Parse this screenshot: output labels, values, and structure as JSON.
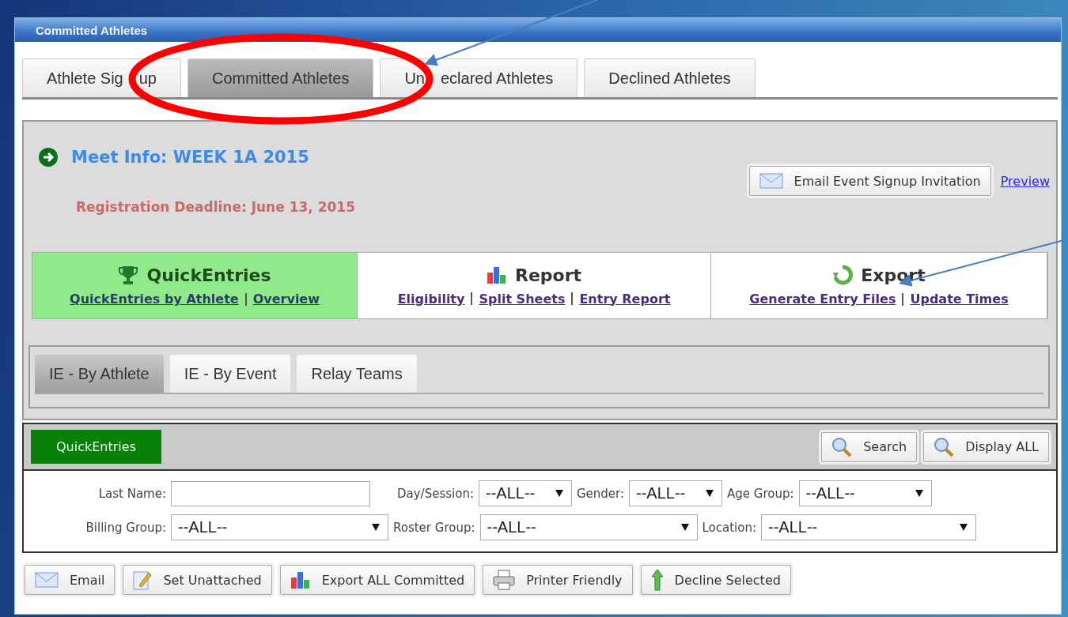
{
  "window": {
    "title": "Committed Athletes"
  },
  "tabs": [
    {
      "label_parts": [
        "Athlete Sig",
        "up"
      ],
      "selected": false
    },
    {
      "label_parts": [
        "Committed Athletes"
      ],
      "selected": true
    },
    {
      "label_parts": [
        "Un",
        "eclared Athletes"
      ],
      "selected": false
    },
    {
      "label_parts": [
        "Declined Athletes"
      ],
      "selected": false
    }
  ],
  "meet": {
    "title": "Meet Info: WEEK 1A 2015",
    "deadline": "Registration Deadline: June 13, 2015",
    "email_button": "Email Event Signup Invitation",
    "preview_link": "Preview"
  },
  "sections": [
    {
      "kind": "trophy",
      "title": "QuickEntries",
      "selected": true,
      "links": [
        "QuickEntries by Athlete",
        "Overview"
      ]
    },
    {
      "kind": "chart",
      "title": "Report",
      "selected": false,
      "links": [
        "Eligibility",
        "Split Sheets",
        "Entry Report"
      ]
    },
    {
      "kind": "recycle",
      "title": "Export",
      "selected": false,
      "links": [
        "Generate Entry Files",
        "Update Times"
      ]
    }
  ],
  "subtabs": [
    {
      "label": "IE - By Athlete",
      "selected": true
    },
    {
      "label": "IE - By Event",
      "selected": false
    },
    {
      "label": "Relay Teams",
      "selected": false
    }
  ],
  "panel": {
    "label": "QuickEntries",
    "buttons": [
      "Search",
      "Display ALL"
    ]
  },
  "filters": [
    [
      {
        "label": "Last Name:",
        "kind": "text"
      },
      {
        "label": "Day/Session:",
        "kind": "select",
        "value": "--ALL--"
      },
      {
        "label": "Gender:",
        "kind": "select",
        "value": "--ALL--"
      },
      {
        "label": "Age Group:",
        "kind": "select",
        "value": "--ALL--"
      }
    ],
    [
      {
        "label": "Billing Group:",
        "kind": "select",
        "value": "--ALL--"
      },
      {
        "label": "Roster Group:",
        "kind": "select",
        "value": "--ALL--"
      },
      {
        "label": "Location:",
        "kind": "select",
        "value": "--ALL--"
      }
    ]
  ],
  "actions": [
    {
      "kind": "mail",
      "label": "Email"
    },
    {
      "kind": "pencil",
      "label": "Set Unattached"
    },
    {
      "kind": "chart",
      "label": "Export ALL Committed"
    },
    {
      "kind": "printer",
      "label": "Printer Friendly"
    },
    {
      "kind": "arrow",
      "label": "Decline Selected"
    }
  ]
}
